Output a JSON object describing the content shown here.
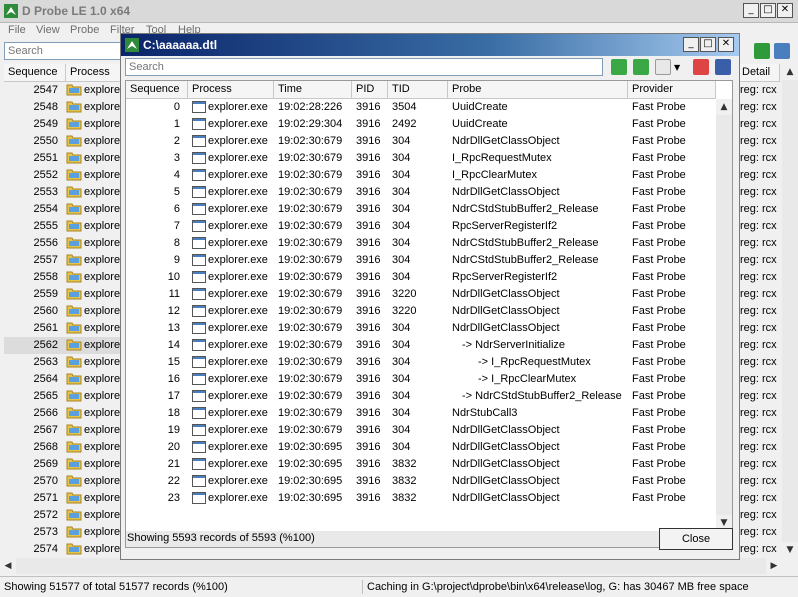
{
  "app": {
    "title": "D Probe LE 1.0 x64",
    "menu": [
      "File",
      "View",
      "Probe",
      "Filter",
      "Tool",
      "Help"
    ],
    "search_placeholder": "Search",
    "columns": [
      "Sequence",
      "Process",
      "Detail"
    ],
    "bg_rows": [
      {
        "seq": "2547",
        "proc": "explore",
        "detail": "reg: rcx"
      },
      {
        "seq": "2548",
        "proc": "explore",
        "detail": "reg: rcx"
      },
      {
        "seq": "2549",
        "proc": "explore",
        "detail": "reg: rcx"
      },
      {
        "seq": "2550",
        "proc": "explore",
        "detail": "reg: rcx"
      },
      {
        "seq": "2551",
        "proc": "explore",
        "detail": "reg: rcx"
      },
      {
        "seq": "2552",
        "proc": "explore",
        "detail": "reg: rcx"
      },
      {
        "seq": "2553",
        "proc": "explore",
        "detail": "reg: rcx"
      },
      {
        "seq": "2554",
        "proc": "explore",
        "detail": "reg: rcx"
      },
      {
        "seq": "2555",
        "proc": "explore",
        "detail": "reg: rcx"
      },
      {
        "seq": "2556",
        "proc": "explore",
        "detail": "reg: rcx"
      },
      {
        "seq": "2557",
        "proc": "explore",
        "detail": "reg: rcx"
      },
      {
        "seq": "2558",
        "proc": "explore",
        "detail": "reg: rcx"
      },
      {
        "seq": "2559",
        "proc": "explore",
        "detail": "reg: rcx"
      },
      {
        "seq": "2560",
        "proc": "explore",
        "detail": "reg: rcx"
      },
      {
        "seq": "2561",
        "proc": "explore",
        "detail": "reg: rcx"
      },
      {
        "seq": "2562",
        "proc": "explore",
        "detail": "reg: rcx"
      },
      {
        "seq": "2563",
        "proc": "explore",
        "detail": "reg: rcx"
      },
      {
        "seq": "2564",
        "proc": "explore",
        "detail": "reg: rcx"
      },
      {
        "seq": "2565",
        "proc": "explore",
        "detail": "reg: rcx"
      },
      {
        "seq": "2566",
        "proc": "explore",
        "detail": "reg: rcx"
      },
      {
        "seq": "2567",
        "proc": "explore",
        "detail": "reg: rcx"
      },
      {
        "seq": "2568",
        "proc": "explore",
        "detail": "reg: rcx"
      },
      {
        "seq": "2569",
        "proc": "explore",
        "detail": "reg: rcx"
      },
      {
        "seq": "2570",
        "proc": "explore",
        "detail": "reg: rcx"
      },
      {
        "seq": "2571",
        "proc": "explore",
        "detail": "reg: rcx"
      },
      {
        "seq": "2572",
        "proc": "explore",
        "detail": "reg: rcx"
      },
      {
        "seq": "2573",
        "proc": "explore",
        "detail": "reg: rcx"
      },
      {
        "seq": "2574",
        "proc": "explore",
        "detail": "reg: rcx"
      }
    ],
    "status_left": "Showing 51577 of total 51577 records (%100)",
    "status_right": "Caching in G:\\project\\dprobe\\bin\\x64\\release\\log, G: has 30467 MB free space"
  },
  "dialog": {
    "title": "C:\\aaaaaa.dtl",
    "search_placeholder": "Search",
    "columns": [
      "Sequence",
      "Process",
      "Time",
      "PID",
      "TID",
      "Probe",
      "Provider"
    ],
    "rows": [
      {
        "seq": "0",
        "proc": "explorer.exe",
        "time": "19:02:28:226",
        "pid": "3916",
        "tid": "3504",
        "probe": "UuidCreate",
        "provider": "Fast Probe"
      },
      {
        "seq": "1",
        "proc": "explorer.exe",
        "time": "19:02:29:304",
        "pid": "3916",
        "tid": "2492",
        "probe": "UuidCreate",
        "provider": "Fast Probe"
      },
      {
        "seq": "2",
        "proc": "explorer.exe",
        "time": "19:02:30:679",
        "pid": "3916",
        "tid": "304",
        "probe": "NdrDllGetClassObject",
        "provider": "Fast Probe"
      },
      {
        "seq": "3",
        "proc": "explorer.exe",
        "time": "19:02:30:679",
        "pid": "3916",
        "tid": "304",
        "probe": "I_RpcRequestMutex",
        "provider": "Fast Probe"
      },
      {
        "seq": "4",
        "proc": "explorer.exe",
        "time": "19:02:30:679",
        "pid": "3916",
        "tid": "304",
        "probe": "I_RpcClearMutex",
        "provider": "Fast Probe"
      },
      {
        "seq": "5",
        "proc": "explorer.exe",
        "time": "19:02:30:679",
        "pid": "3916",
        "tid": "304",
        "probe": "NdrDllGetClassObject",
        "provider": "Fast Probe"
      },
      {
        "seq": "6",
        "proc": "explorer.exe",
        "time": "19:02:30:679",
        "pid": "3916",
        "tid": "304",
        "probe": "NdrCStdStubBuffer2_Release",
        "provider": "Fast Probe"
      },
      {
        "seq": "7",
        "proc": "explorer.exe",
        "time": "19:02:30:679",
        "pid": "3916",
        "tid": "304",
        "probe": "RpcServerRegisterIf2",
        "provider": "Fast Probe"
      },
      {
        "seq": "8",
        "proc": "explorer.exe",
        "time": "19:02:30:679",
        "pid": "3916",
        "tid": "304",
        "probe": "NdrCStdStubBuffer2_Release",
        "provider": "Fast Probe"
      },
      {
        "seq": "9",
        "proc": "explorer.exe",
        "time": "19:02:30:679",
        "pid": "3916",
        "tid": "304",
        "probe": "NdrCStdStubBuffer2_Release",
        "provider": "Fast Probe"
      },
      {
        "seq": "10",
        "proc": "explorer.exe",
        "time": "19:02:30:679",
        "pid": "3916",
        "tid": "304",
        "probe": "RpcServerRegisterIf2",
        "provider": "Fast Probe"
      },
      {
        "seq": "11",
        "proc": "explorer.exe",
        "time": "19:02:30:679",
        "pid": "3916",
        "tid": "3220",
        "probe": "NdrDllGetClassObject",
        "provider": "Fast Probe"
      },
      {
        "seq": "12",
        "proc": "explorer.exe",
        "time": "19:02:30:679",
        "pid": "3916",
        "tid": "3220",
        "probe": "NdrDllGetClassObject",
        "provider": "Fast Probe"
      },
      {
        "seq": "13",
        "proc": "explorer.exe",
        "time": "19:02:30:679",
        "pid": "3916",
        "tid": "304",
        "probe": "NdrDllGetClassObject",
        "provider": "Fast Probe"
      },
      {
        "seq": "14",
        "proc": "explorer.exe",
        "time": "19:02:30:679",
        "pid": "3916",
        "tid": "304",
        "probe": "-> NdrServerInitialize",
        "provider": "Fast Probe",
        "indent": 1
      },
      {
        "seq": "15",
        "proc": "explorer.exe",
        "time": "19:02:30:679",
        "pid": "3916",
        "tid": "304",
        "probe": "-> I_RpcRequestMutex",
        "provider": "Fast Probe",
        "indent": 2
      },
      {
        "seq": "16",
        "proc": "explorer.exe",
        "time": "19:02:30:679",
        "pid": "3916",
        "tid": "304",
        "probe": "-> I_RpcClearMutex",
        "provider": "Fast Probe",
        "indent": 2
      },
      {
        "seq": "17",
        "proc": "explorer.exe",
        "time": "19:02:30:679",
        "pid": "3916",
        "tid": "304",
        "probe": "-> NdrCStdStubBuffer2_Release",
        "provider": "Fast Probe",
        "indent": 1
      },
      {
        "seq": "18",
        "proc": "explorer.exe",
        "time": "19:02:30:679",
        "pid": "3916",
        "tid": "304",
        "probe": "NdrStubCall3",
        "provider": "Fast Probe"
      },
      {
        "seq": "19",
        "proc": "explorer.exe",
        "time": "19:02:30:679",
        "pid": "3916",
        "tid": "304",
        "probe": "NdrDllGetClassObject",
        "provider": "Fast Probe"
      },
      {
        "seq": "20",
        "proc": "explorer.exe",
        "time": "19:02:30:695",
        "pid": "3916",
        "tid": "304",
        "probe": "NdrDllGetClassObject",
        "provider": "Fast Probe"
      },
      {
        "seq": "21",
        "proc": "explorer.exe",
        "time": "19:02:30:695",
        "pid": "3916",
        "tid": "3832",
        "probe": "NdrDllGetClassObject",
        "provider": "Fast Probe"
      },
      {
        "seq": "22",
        "proc": "explorer.exe",
        "time": "19:02:30:695",
        "pid": "3916",
        "tid": "3832",
        "probe": "NdrDllGetClassObject",
        "provider": "Fast Probe"
      },
      {
        "seq": "23",
        "proc": "explorer.exe",
        "time": "19:02:30:695",
        "pid": "3916",
        "tid": "3832",
        "probe": "NdrDllGetClassObject",
        "provider": "Fast Probe"
      }
    ],
    "status": "Showing 5593 records of 5593 (%100)",
    "close_label": "Close"
  }
}
